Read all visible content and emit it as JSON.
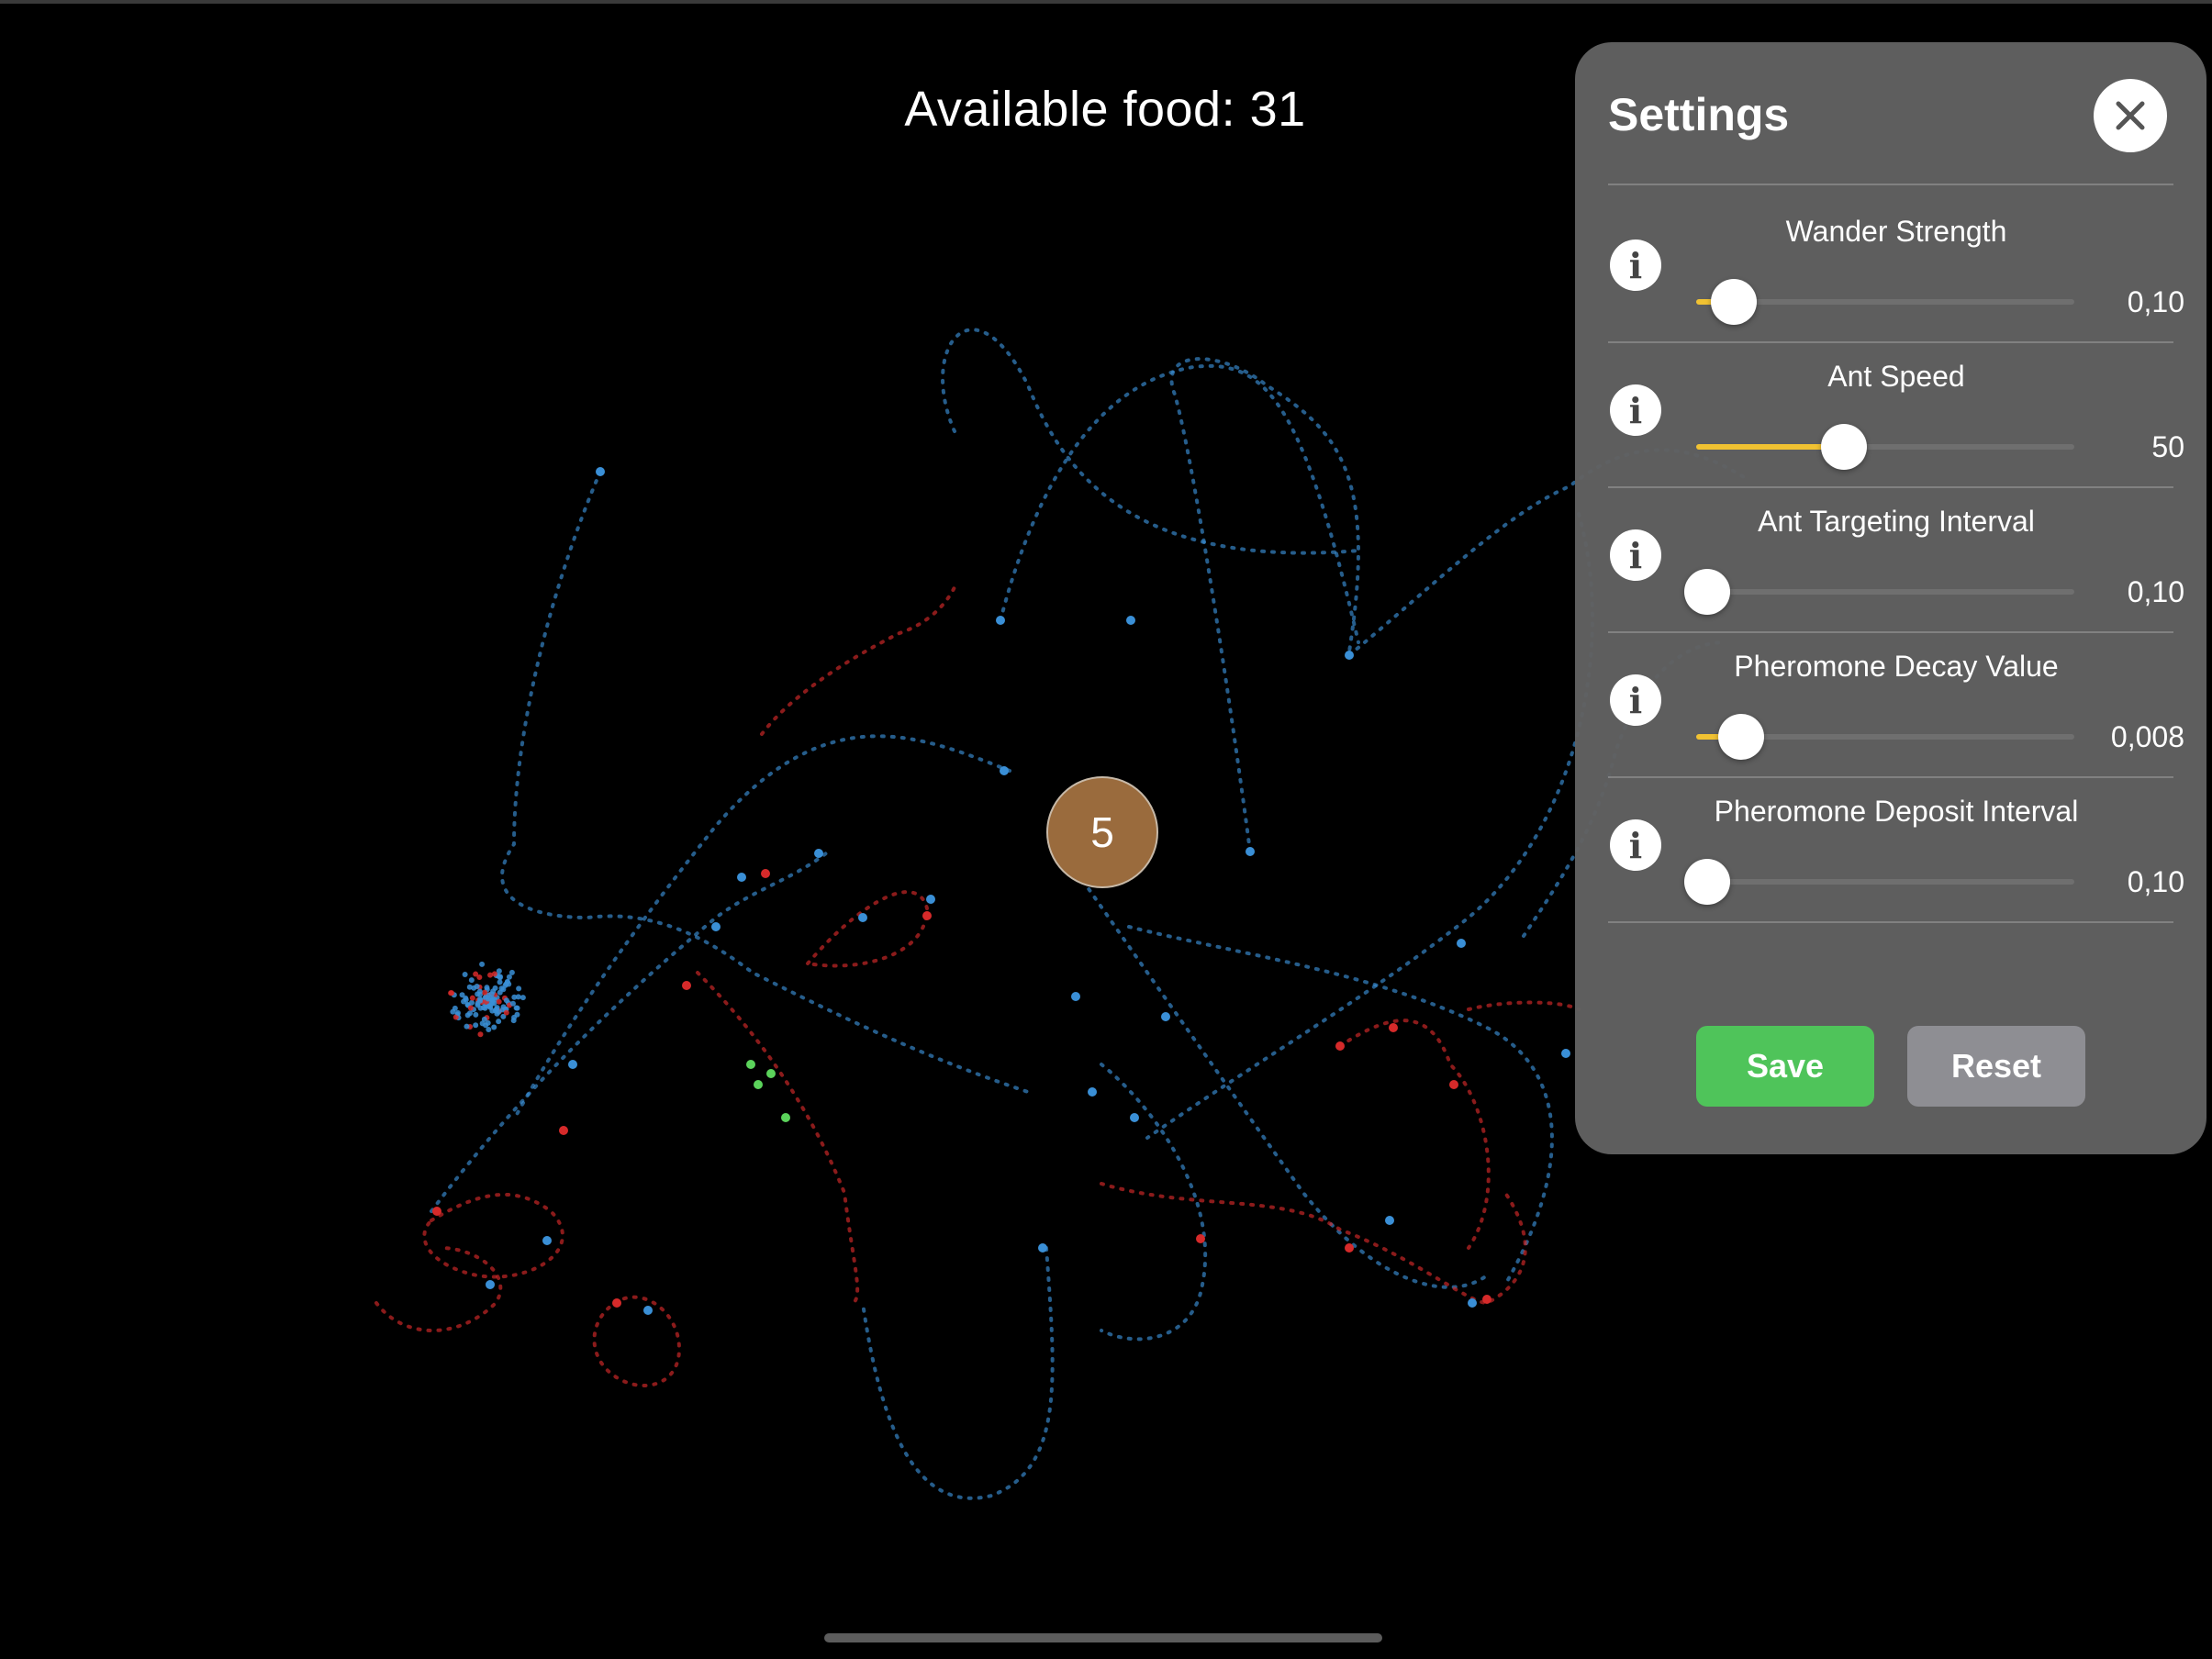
{
  "hud": {
    "food_label": "Available food: 31"
  },
  "nest": {
    "count": "5",
    "color": "#9a6b3d"
  },
  "trail_colors": {
    "explore": "#3a8fd6",
    "return": "#d62a2a",
    "food": "#5bd35b"
  },
  "settings": {
    "title": "Settings",
    "close_icon": "close-icon",
    "items": [
      {
        "label": "Wander Strength",
        "value_text": "0,10",
        "fraction": 0.1
      },
      {
        "label": "Ant Speed",
        "value_text": "50",
        "fraction": 0.39
      },
      {
        "label": "Ant Targeting Interval",
        "value_text": "0,10",
        "fraction": 0.03
      },
      {
        "label": "Pheromone Decay Value",
        "value_text": "0,008",
        "fraction": 0.12
      },
      {
        "label": "Pheromone Deposit Interval",
        "value_text": "0,10",
        "fraction": 0.03
      }
    ],
    "save_label": "Save",
    "reset_label": "Reset",
    "accent_color": "#f1c232",
    "save_color": "#4fc45a"
  }
}
